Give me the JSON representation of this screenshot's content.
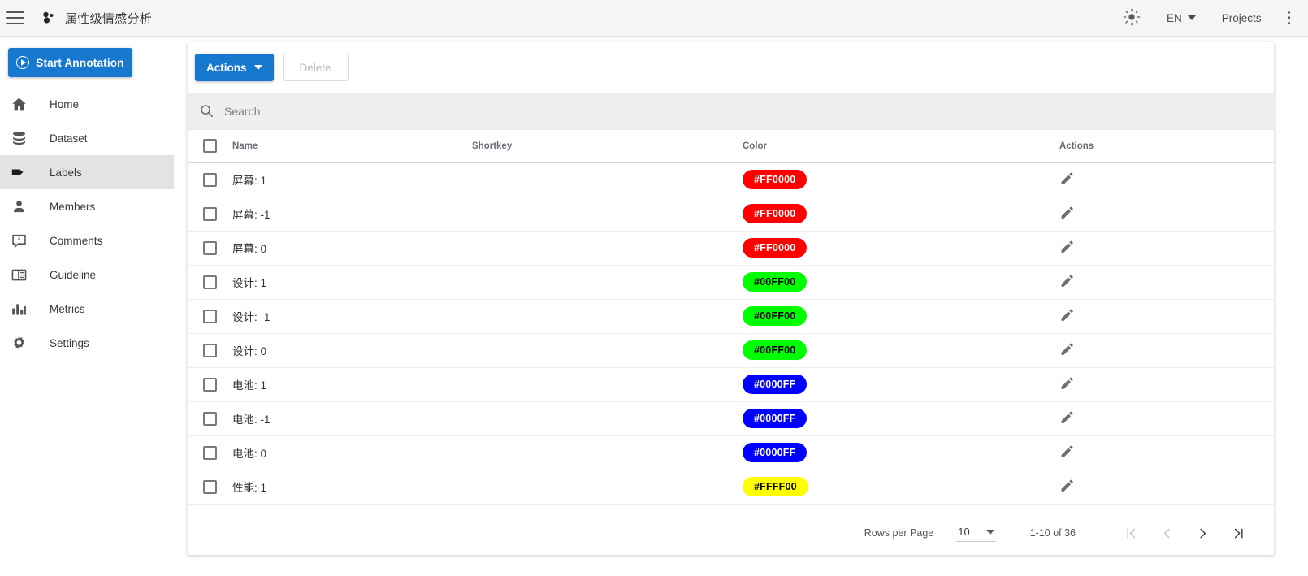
{
  "appbar": {
    "menu_icon": "hamburger-icon",
    "logo_icon": "app-logo-icon",
    "title": "属性级情感分析",
    "theme_icon": "sun-icon",
    "language": "EN",
    "projects_label": "Projects",
    "overflow_icon": "kebab-menu-icon"
  },
  "sidebar": {
    "start_button": {
      "label": "Start Annotation",
      "icon": "play-circle-icon",
      "color": "#1778d0"
    },
    "items": [
      {
        "label": "Home",
        "icon": "home-icon",
        "active": false
      },
      {
        "label": "Dataset",
        "icon": "database-icon",
        "active": false
      },
      {
        "label": "Labels",
        "icon": "tag-icon",
        "active": true
      },
      {
        "label": "Members",
        "icon": "person-icon",
        "active": false
      },
      {
        "label": "Comments",
        "icon": "comment-icon",
        "active": false
      },
      {
        "label": "Guideline",
        "icon": "book-icon",
        "active": false
      },
      {
        "label": "Metrics",
        "icon": "bar-chart-icon",
        "active": false
      },
      {
        "label": "Settings",
        "icon": "gear-icon",
        "active": false
      }
    ]
  },
  "toolbar": {
    "actions_label": "Actions",
    "delete_label": "Delete",
    "delete_disabled": true
  },
  "search": {
    "placeholder": "Search",
    "value": "",
    "icon": "search-icon"
  },
  "table": {
    "columns": [
      "Name",
      "Shortkey",
      "Color",
      "Actions"
    ],
    "rows": [
      {
        "name": "屏幕:",
        "value": "1",
        "shortkey": "",
        "color": "#FF0000",
        "color_text": "#FF0000",
        "text_on": "#ffffff",
        "edit_icon": "pencil-icon"
      },
      {
        "name": "屏幕:",
        "value": "-1",
        "shortkey": "",
        "color": "#FF0000",
        "color_text": "#FF0000",
        "text_on": "#ffffff",
        "edit_icon": "pencil-icon"
      },
      {
        "name": "屏幕:",
        "value": "0",
        "shortkey": "",
        "color": "#FF0000",
        "color_text": "#FF0000",
        "text_on": "#ffffff",
        "edit_icon": "pencil-icon"
      },
      {
        "name": "设计:",
        "value": "1",
        "shortkey": "",
        "color": "#00FF00",
        "color_text": "#00FF00",
        "text_on": "#000000",
        "edit_icon": "pencil-icon"
      },
      {
        "name": "设计:",
        "value": "-1",
        "shortkey": "",
        "color": "#00FF00",
        "color_text": "#00FF00",
        "text_on": "#000000",
        "edit_icon": "pencil-icon"
      },
      {
        "name": "设计:",
        "value": "0",
        "shortkey": "",
        "color": "#00FF00",
        "color_text": "#00FF00",
        "text_on": "#000000",
        "edit_icon": "pencil-icon"
      },
      {
        "name": "电池:",
        "value": "1",
        "shortkey": "",
        "color": "#0000FF",
        "color_text": "#0000FF",
        "text_on": "#ffffff",
        "edit_icon": "pencil-icon"
      },
      {
        "name": "电池:",
        "value": "-1",
        "shortkey": "",
        "color": "#0000FF",
        "color_text": "#0000FF",
        "text_on": "#ffffff",
        "edit_icon": "pencil-icon"
      },
      {
        "name": "电池:",
        "value": "0",
        "shortkey": "",
        "color": "#0000FF",
        "color_text": "#0000FF",
        "text_on": "#ffffff",
        "edit_icon": "pencil-icon"
      },
      {
        "name": "性能:",
        "value": "1",
        "shortkey": "",
        "color": "#FFFF00",
        "color_text": "#FFFF00",
        "text_on": "#000000",
        "edit_icon": "pencil-icon"
      }
    ]
  },
  "pagination": {
    "rows_per_page_label": "Rows per Page",
    "rows_per_page_value": "10",
    "range_label": "1-10 of 36",
    "first_icon": "first-page-icon",
    "prev_icon": "previous-page-icon",
    "next_icon": "next-page-icon",
    "last_icon": "last-page-icon",
    "first_enabled": false,
    "prev_enabled": false,
    "next_enabled": true,
    "last_enabled": true
  }
}
